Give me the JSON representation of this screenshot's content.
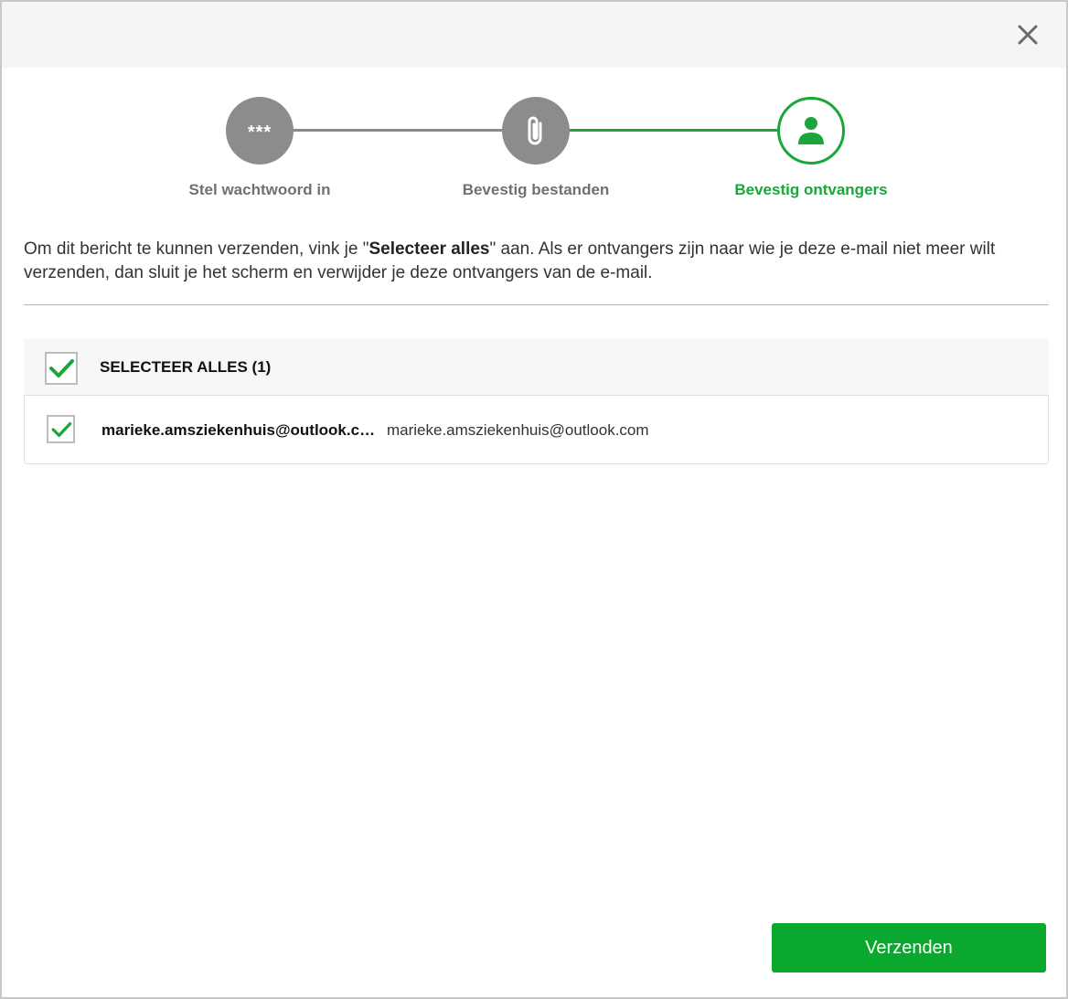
{
  "header": {
    "close_icon": "close-icon"
  },
  "stepper": {
    "steps": [
      {
        "label": "Stel wachtwoord in",
        "icon": "password-dots-icon",
        "icon_text": "***",
        "state": "done"
      },
      {
        "label": "Bevestig bestanden",
        "icon": "paperclip-icon",
        "state": "done"
      },
      {
        "label": "Bevestig ontvangers",
        "icon": "person-icon",
        "state": "active"
      }
    ]
  },
  "info": {
    "text_before": "Om dit bericht te kunnen verzenden, vink je \"",
    "bold": "Selecteer alles",
    "text_after": "\" aan. Als er ontvangers zijn naar wie je deze e-mail niet meer wilt verzenden, dan sluit je het scherm en verwijder je deze ontvangers van de e-mail."
  },
  "select_all": {
    "label": "SELECTEER ALLES (1)",
    "checked": true
  },
  "recipients": [
    {
      "name": "marieke.amsziekenhuis@outlook.com",
      "email": "marieke.amsziekenhuis@outlook.com",
      "checked": true
    }
  ],
  "actions": {
    "send_label": "Verzenden"
  },
  "colors": {
    "accent": "#1aa63a",
    "button": "#0aa82f",
    "step_done": "#8c8c8c"
  }
}
